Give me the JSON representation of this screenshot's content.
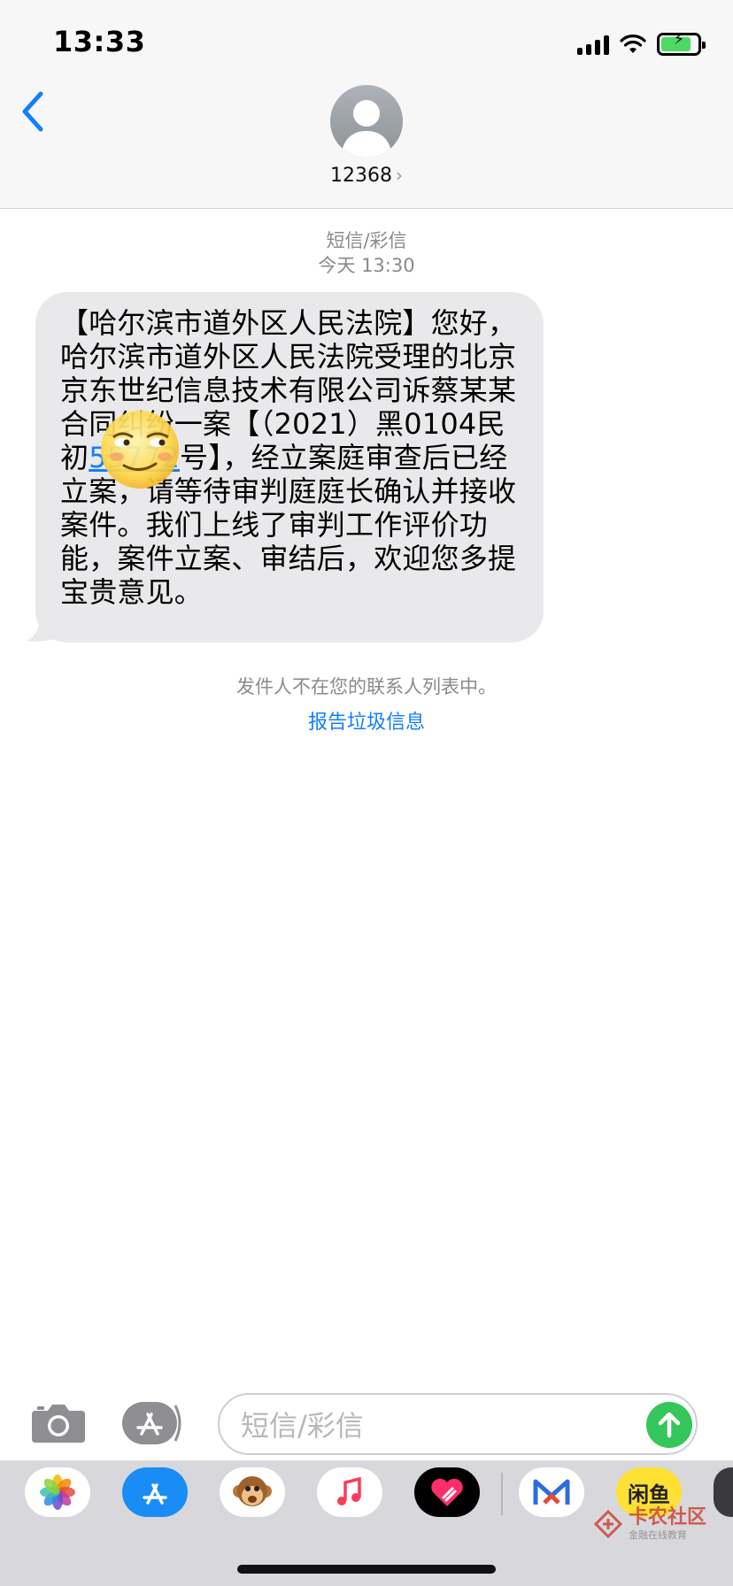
{
  "status_bar": {
    "time": "13:33"
  },
  "header": {
    "contact_name": "12368",
    "chevron": "›",
    "back_icon": "chevron-left-icon"
  },
  "thread": {
    "service_label": "短信/彩信",
    "timestamp": "今天 13:30",
    "message": {
      "prefix": "【哈尔滨市道外区人民法院】您好，哈尔滨市道外区人民法院受理的北京京东世纪信息技术有限公司诉蔡某某合同纠纷一案【（2021）黑0104民初",
      "link_number": "55772",
      "suffix": "号】，经立案庭审查后已经立案，请等待审判庭庭长确认并接收案件。我们上线了审判工作评价功能，案件立案、审结后，欢迎您多提宝贵意见。"
    },
    "notice": "发件人不在您的联系人列表中。",
    "report_link": "报告垃圾信息"
  },
  "compose": {
    "placeholder": "短信/彩信",
    "camera_icon": "camera-icon",
    "appstore_icon": "app-store-icon",
    "send_icon": "send-arrow-icon"
  },
  "app_drawer": {
    "apps": [
      "photos",
      "app-store",
      "animoji",
      "music",
      "digital-touch",
      "mafengwo",
      "xianyu"
    ],
    "xianyu_label": "闲鱼",
    "watermark_title": "卡农社区",
    "watermark_sub": "金融在线教育"
  },
  "colors": {
    "accent": "#147efb",
    "bubble": "#e9e9eb",
    "send": "#34c759"
  }
}
